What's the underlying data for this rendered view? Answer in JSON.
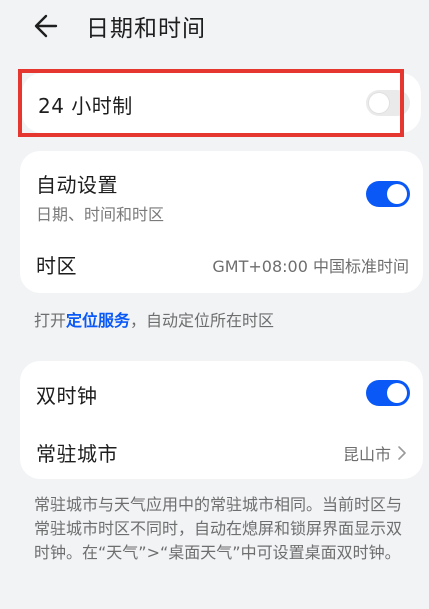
{
  "header": {
    "title": "日期和时间"
  },
  "time_format": {
    "label": "24 小时制",
    "enabled": false
  },
  "auto_settings": {
    "label": "自动设置",
    "sub": "日期、时间和时区",
    "enabled": true
  },
  "timezone": {
    "label": "时区",
    "value": "GMT+08:00 中国标准时间"
  },
  "location_note": {
    "prefix": "打开",
    "link": "定位服务",
    "suffix": "，自动定位所在时区"
  },
  "dual_clock": {
    "label": "双时钟",
    "enabled": true
  },
  "home_city": {
    "label": "常驻城市",
    "value": "昆山市"
  },
  "footnote": "常驻城市与天气应用中的常驻城市相同。当前时区与常驻城市时区不同时，自动在熄屏和锁屏界面显示双时钟。在“天气”>“桌面天气”中可设置桌面双时钟。",
  "colors": {
    "accent": "#0a59f7",
    "highlight": "#e5372f",
    "background": "#f1f3f5"
  }
}
